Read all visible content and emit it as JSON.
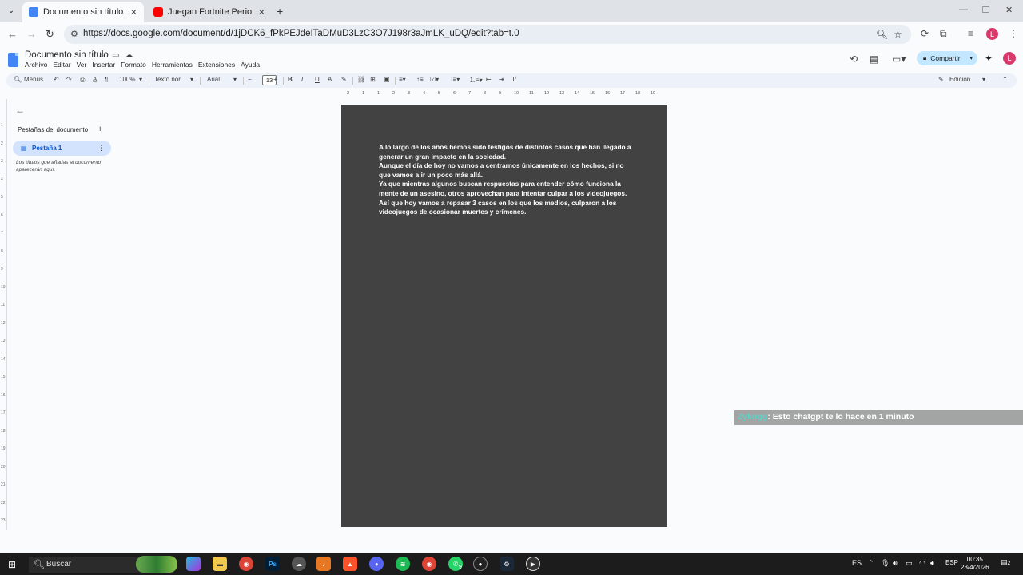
{
  "browser": {
    "tabs": [
      {
        "title": "Documento sin título - Docume",
        "active": true,
        "favicon_color": "#4285f4"
      },
      {
        "title": "Juegan Fortnite Periodistas de ",
        "active": false,
        "favicon_color": "#ff0000"
      }
    ],
    "new_tab": "+",
    "url": "https://docs.google.com/document/d/1jDCK6_fPkPEJdeITaDMuD3LzC3O7J198r3aJmLK_uDQ/edit?tab=t.0",
    "profile_initial": "L"
  },
  "docs": {
    "title": "Documento sin título",
    "menu": [
      "Archivo",
      "Editar",
      "Ver",
      "Insertar",
      "Formato",
      "Herramientas",
      "Extensiones",
      "Ayuda"
    ],
    "share_label": "Compartir",
    "profile_initial": "L",
    "toolbar": {
      "menus_label": "Menús",
      "zoom": "100%",
      "style": "Texto nor...",
      "font": "Arial",
      "font_size": "13",
      "mode": "Edición"
    }
  },
  "tabs_panel": {
    "heading": "Pestañas del documento",
    "tab_label": "Pestaña 1",
    "note": "Los títulos que añadas al documento aparecerán aquí."
  },
  "ruler": {
    "h_ticks": [
      "2",
      "1",
      "1",
      "2",
      "3",
      "4",
      "5",
      "6",
      "7",
      "8",
      "9",
      "10",
      "11",
      "12",
      "13",
      "14",
      "15",
      "16",
      "17",
      "18",
      "19"
    ],
    "v_ticks": [
      "1",
      "2",
      "3",
      "4",
      "5",
      "6",
      "7",
      "8",
      "9",
      "10",
      "11",
      "12",
      "13",
      "14",
      "15",
      "16",
      "17",
      "18",
      "19",
      "20",
      "21",
      "22",
      "23"
    ]
  },
  "document": {
    "paragraphs": [
      "A lo largo de los años hemos sido testigos de distintos casos que han llegado a generar un gran impacto en la sociedad.",
      "Aunque el día de hoy no vamos a centrarnos únicamente en los hechos, si no que vamos a ir un poco más allá.",
      "Ya que mientras algunos buscan respuestas para entender cómo funciona la mente de un asesino, otros aprovechan para intentar culpar a los videojuegos.",
      "Así que hoy vamos a repasar 3 casos en los que los medios, culparon a los videojuegos de ocasionar muertes y crímenes."
    ]
  },
  "chat": {
    "user": "Zykogg",
    "message": ": Esto chatgpt te lo hace en 1 minuto"
  },
  "taskbar": {
    "search_placeholder": "Buscar",
    "language": "ES",
    "keyboard": "ESP",
    "time": "00:35",
    "date": "23/4/2026",
    "notifications": "2",
    "badge": "9"
  }
}
